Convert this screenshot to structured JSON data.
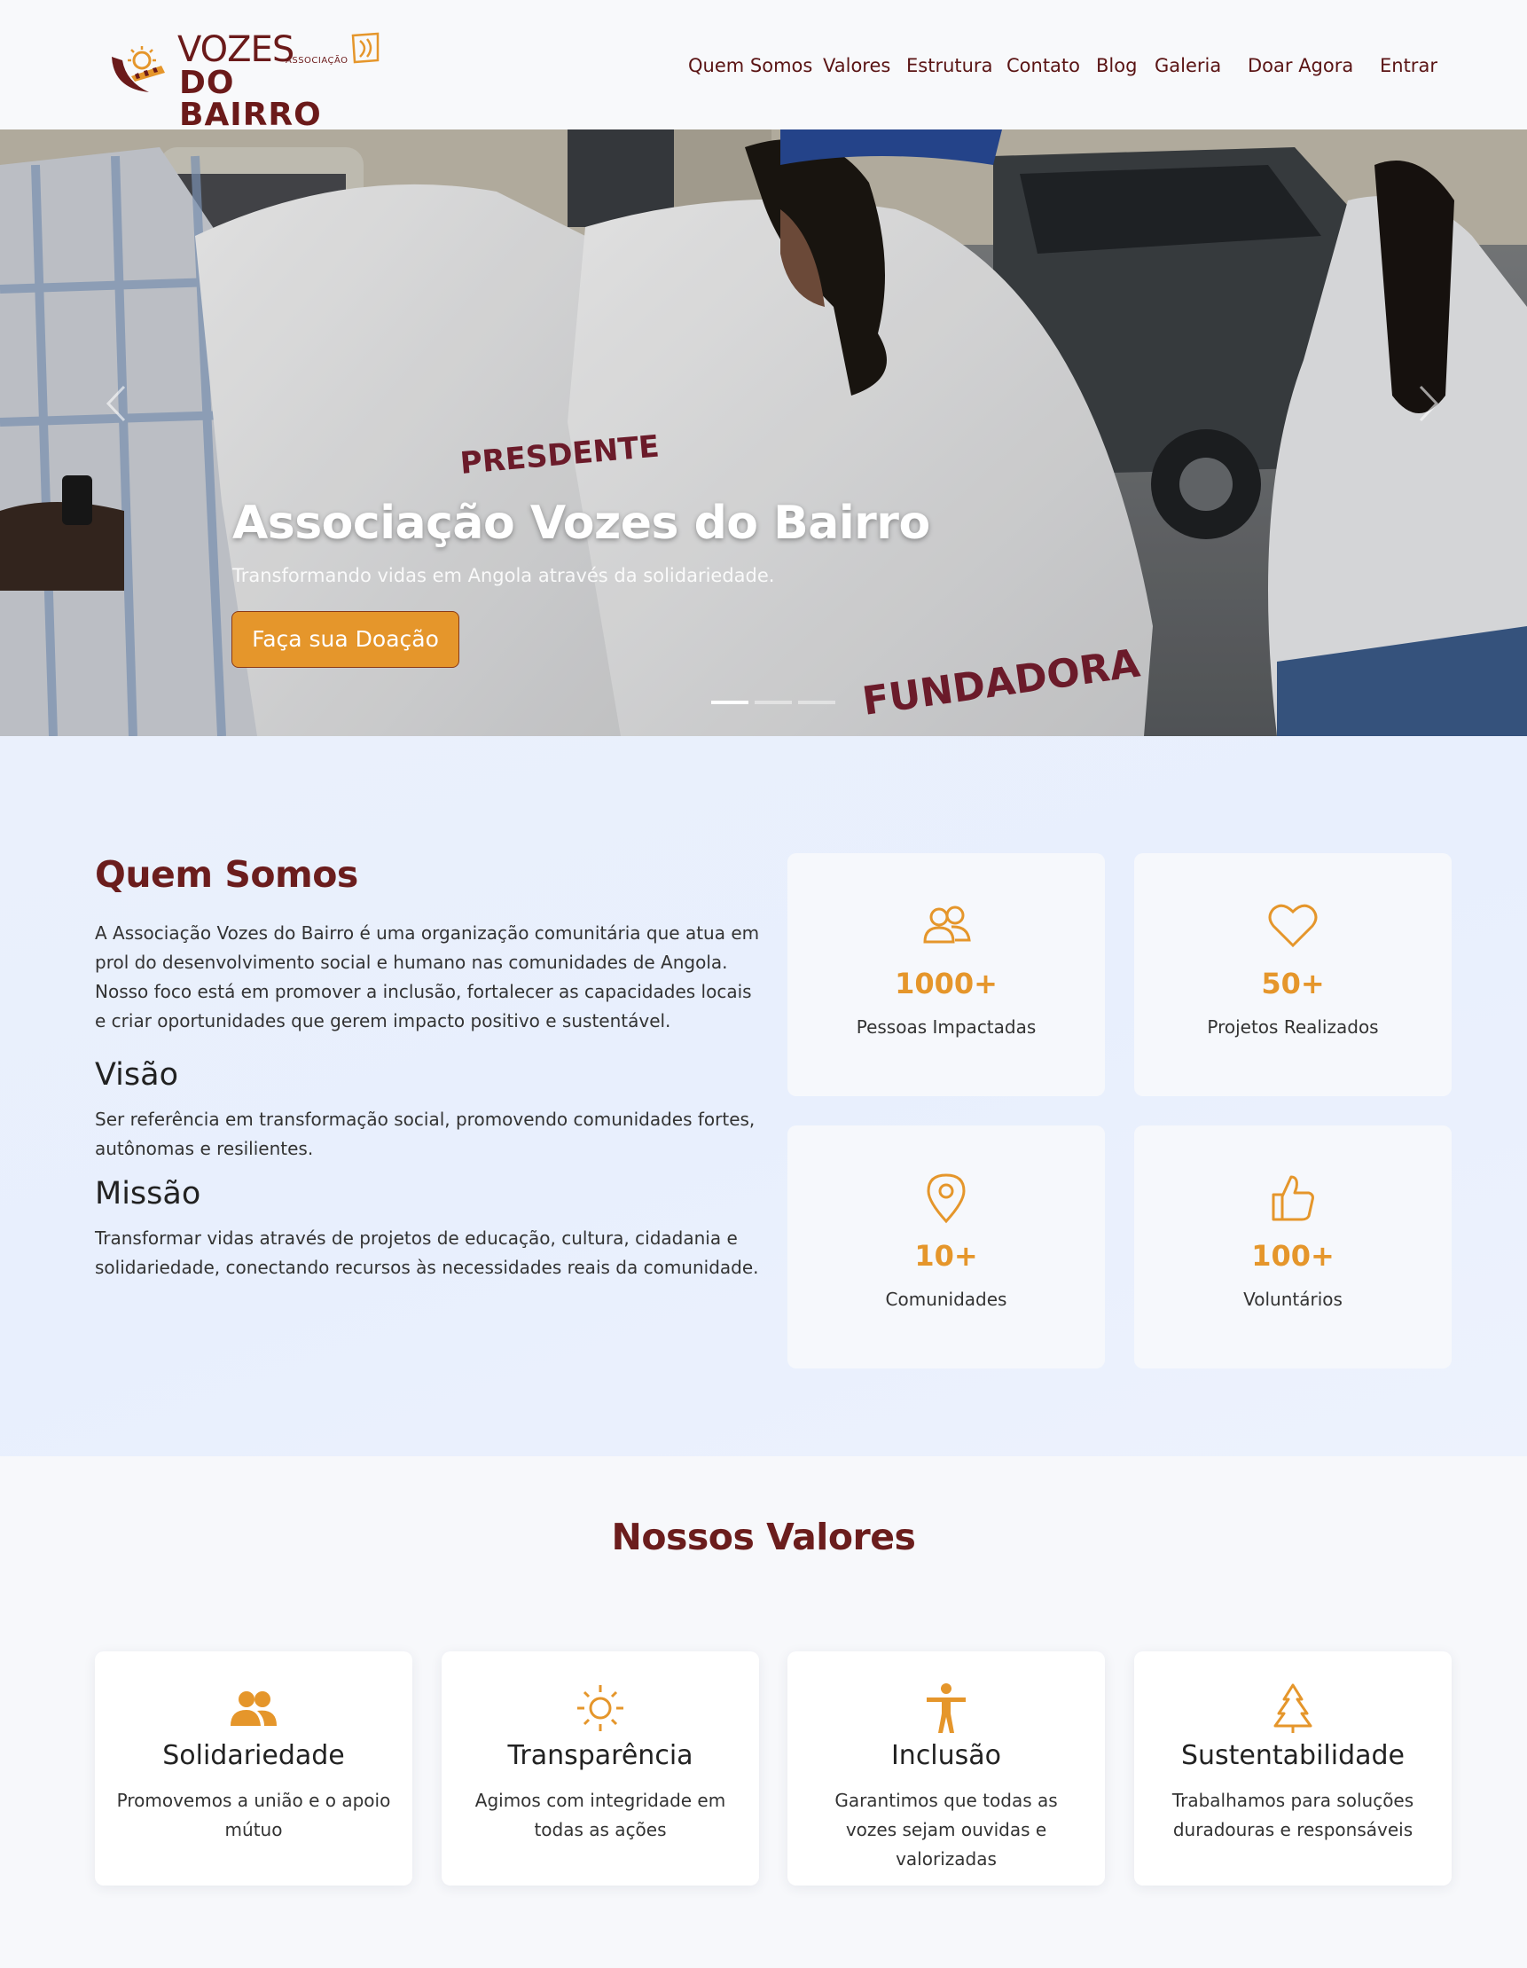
{
  "brand": {
    "line1": "VOZES",
    "tag": "ASSOCIAÇÃO",
    "line2": "DO BAIRRO"
  },
  "nav": {
    "items": [
      "Quem Somos",
      "Valores",
      "Estrutura",
      "Contato",
      "Blog",
      "Galeria"
    ],
    "donate": "Doar Agora",
    "login": "Entrar"
  },
  "hero": {
    "title": "Associação Vozes do Bairro",
    "subtitle": "Transformando vidas em Angola através da solidariedade.",
    "button": "Faça sua Doação",
    "shirt_text_1": "PRESDENTE",
    "shirt_text_2": "FUNDADORA",
    "slides": 3,
    "active_slide": 1
  },
  "about": {
    "title": "Quem Somos",
    "intro": "A Associação Vozes do Bairro é uma organização comunitária que atua em prol do desenvolvimento social e humano nas comunidades de Angola. Nosso foco está em promover a inclusão, fortalecer as capacidades locais e criar oportunidades que gerem impacto positivo e sustentável.",
    "vision_title": "Visão",
    "vision_text": "Ser referência em transformação social, promovendo comunidades fortes, autônomas e resilientes.",
    "mission_title": "Missão",
    "mission_text": "Transformar vidas através de projetos de educação, cultura, cidadania e solidariedade, conectando recursos às necessidades reais da comunidade."
  },
  "stats": [
    {
      "icon": "people-icon",
      "value": "1000+",
      "label": "Pessoas Impactadas"
    },
    {
      "icon": "heart-icon",
      "value": "50+",
      "label": "Projetos Realizados"
    },
    {
      "icon": "location-pin-icon",
      "value": "10+",
      "label": "Comunidades"
    },
    {
      "icon": "thumbs-up-icon",
      "value": "100+",
      "label": "Voluntários"
    }
  ],
  "values": {
    "title": "Nossos Valores",
    "items": [
      {
        "icon": "people-filled-icon",
        "title": "Solidariedade",
        "desc": "Promovemos a união e o apoio mútuo"
      },
      {
        "icon": "sun-icon",
        "title": "Transparência",
        "desc": "Agimos com integridade em todas as ações"
      },
      {
        "icon": "person-icon",
        "title": "Inclusão",
        "desc": "Garantimos que todas as vozes sejam ouvidas e valorizadas"
      },
      {
        "icon": "tree-icon",
        "title": "Sustentabilidade",
        "desc": "Trabalhamos para soluções duradouras e responsáveis"
      }
    ]
  },
  "colors": {
    "brand_maroon": "#6b1d1d",
    "accent_orange": "#e5962b",
    "section_bg": "#eaf0fc",
    "page_bg": "#f7f8fb"
  }
}
